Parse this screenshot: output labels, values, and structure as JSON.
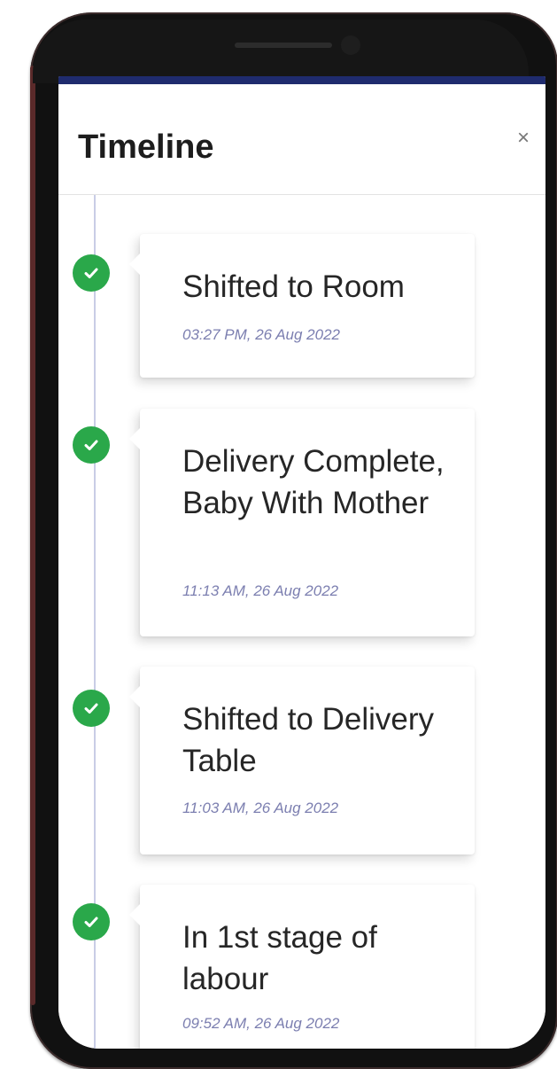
{
  "header": {
    "title": "Timeline",
    "close_symbol": "×"
  },
  "timeline": {
    "items": [
      {
        "title": "Shifted to Room",
        "time": "03:27 PM, 26 Aug 2022",
        "status_icon": "check-icon"
      },
      {
        "title": "Delivery Complete, Baby With Mother",
        "time": "11:13 AM, 26 Aug 2022",
        "status_icon": "check-icon"
      },
      {
        "title": "Shifted to Delivery Table",
        "time": "11:03 AM, 26 Aug 2022",
        "status_icon": "check-icon"
      },
      {
        "title": "In 1st stage of labour",
        "time": "09:52 AM, 26 Aug 2022",
        "status_icon": "check-icon"
      }
    ]
  },
  "colors": {
    "accent_green": "#2aa84a",
    "status_bar": "#1f2b6e",
    "timestamp": "#7c7fb0"
  }
}
